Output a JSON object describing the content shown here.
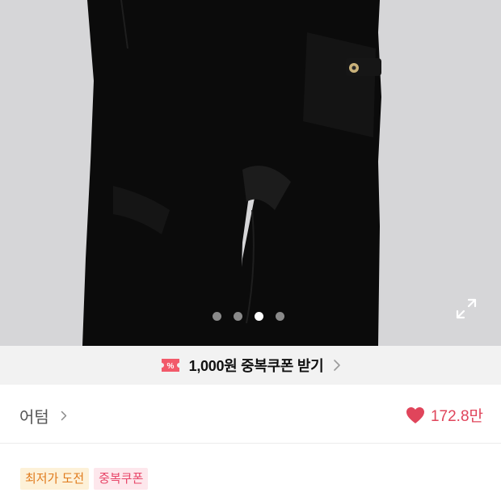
{
  "product_image": {
    "alt": "",
    "carousel": {
      "dot_count": 4,
      "active_index": 2
    },
    "expand_icon": "expand-icon"
  },
  "coupon_banner": {
    "icon": "coupon-ticket-icon",
    "text": "1,000원 중복쿠폰 받기",
    "chevron_icon": "chevron-right-icon"
  },
  "brand": {
    "name": "어텀",
    "chevron_icon": "chevron-right-icon"
  },
  "likes": {
    "icon": "heart-icon",
    "count": "172.8만"
  },
  "tags": [
    {
      "label": "최저가 도전"
    },
    {
      "label": "중복쿠폰"
    }
  ],
  "colors": {
    "accent_red": "#e0455b",
    "coupon_icon_red": "#f25a6a",
    "image_background": "#d6d6d8",
    "tag_lowest_bg": "#fdf1d8",
    "tag_lowest_text": "#e07a1c",
    "tag_coupon_bg": "#fde7ec",
    "tag_coupon_text": "#e8476a"
  }
}
